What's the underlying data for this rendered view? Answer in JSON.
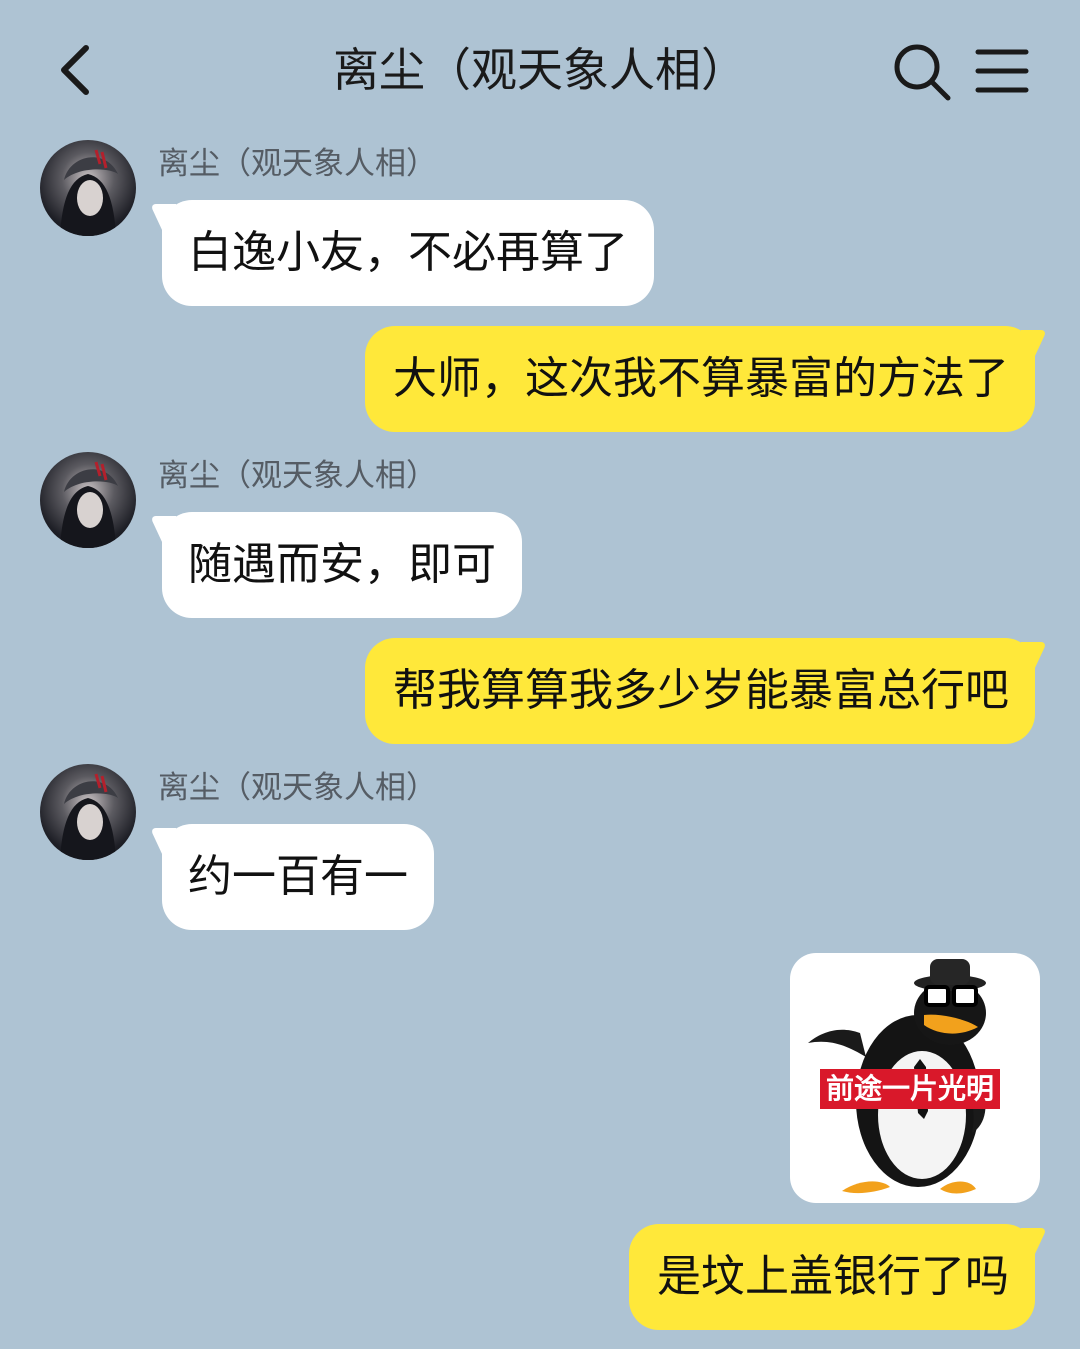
{
  "header": {
    "title": "离尘（观天象人相）",
    "back_icon": "chevron-left-icon",
    "search_icon": "search-icon",
    "menu_icon": "menu-icon"
  },
  "messages": [
    {
      "sender": "离尘（观天象人相）",
      "text": "白逸小友，不必再算了"
    },
    {
      "text": "大师，这次我不算暴富的方法了"
    },
    {
      "sender": "离尘（观天象人相）",
      "text": "随遇而安，即可"
    },
    {
      "text": "帮我算算我多少岁能暴富总行吧"
    },
    {
      "sender": "离尘（观天象人相）",
      "text": "约一百有一"
    },
    {
      "sticker_caption": "前途一片光明"
    },
    {
      "text": "是坟上盖银行了吗"
    }
  ],
  "colors": {
    "background": "#aec3d3",
    "incoming_bubble": "#ffffff",
    "outgoing_bubble": "#ffe83a",
    "sticker_label": "#d9182a"
  }
}
